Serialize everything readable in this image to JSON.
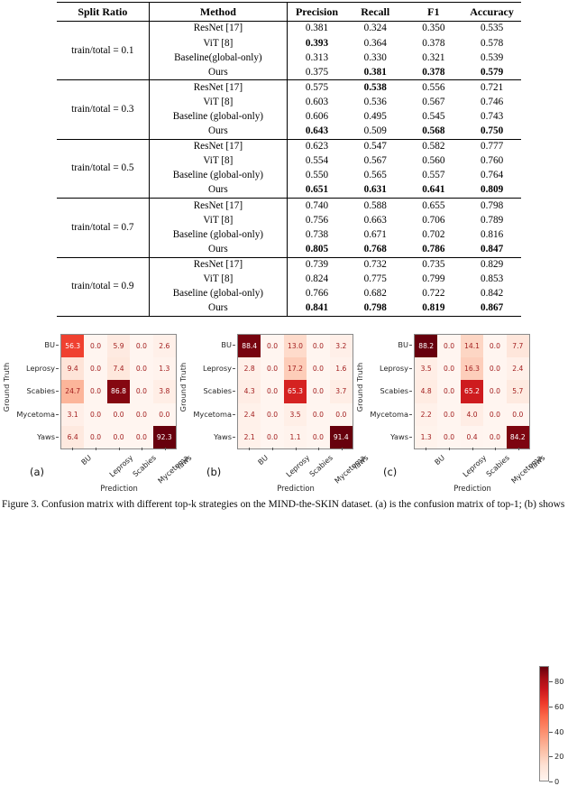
{
  "table": {
    "headers": [
      "Split Ratio",
      "Method",
      "Precision",
      "Recall",
      "F1",
      "Accuracy"
    ],
    "groups": [
      {
        "split": "train/total = 0.1",
        "rows": [
          {
            "method": "ResNet [17]",
            "precision": "0.381",
            "recall": "0.324",
            "f1": "0.350",
            "accuracy": "0.535",
            "bold": {
              "precision": false,
              "recall": false,
              "f1": false,
              "accuracy": false
            }
          },
          {
            "method": "ViT [8]",
            "precision": "0.393",
            "recall": "0.364",
            "f1": "0.378",
            "accuracy": "0.578",
            "bold": {
              "precision": true,
              "recall": false,
              "f1": false,
              "accuracy": false
            }
          },
          {
            "method": "Baseline(global-only)",
            "precision": "0.313",
            "recall": "0.330",
            "f1": "0.321",
            "accuracy": "0.539",
            "bold": {
              "precision": false,
              "recall": false,
              "f1": false,
              "accuracy": false
            }
          },
          {
            "method": "Ours",
            "precision": "0.375",
            "recall": "0.381",
            "f1": "0.378",
            "accuracy": "0.579",
            "bold": {
              "precision": false,
              "recall": true,
              "f1": true,
              "accuracy": true
            }
          }
        ]
      },
      {
        "split": "train/total = 0.3",
        "rows": [
          {
            "method": "ResNet [17]",
            "precision": "0.575",
            "recall": "0.538",
            "f1": "0.556",
            "accuracy": "0.721",
            "bold": {
              "precision": false,
              "recall": true,
              "f1": false,
              "accuracy": false
            }
          },
          {
            "method": "ViT [8]",
            "precision": "0.603",
            "recall": "0.536",
            "f1": "0.567",
            "accuracy": "0.746",
            "bold": {
              "precision": false,
              "recall": false,
              "f1": false,
              "accuracy": false
            }
          },
          {
            "method": "Baseline (global-only)",
            "precision": "0.606",
            "recall": "0.495",
            "f1": "0.545",
            "accuracy": "0.743",
            "bold": {
              "precision": false,
              "recall": false,
              "f1": false,
              "accuracy": false
            }
          },
          {
            "method": "Ours",
            "precision": "0.643",
            "recall": "0.509",
            "f1": "0.568",
            "accuracy": "0.750",
            "bold": {
              "precision": true,
              "recall": false,
              "f1": true,
              "accuracy": true
            }
          }
        ]
      },
      {
        "split": "train/total = 0.5",
        "rows": [
          {
            "method": "ResNet [17]",
            "precision": "0.623",
            "recall": "0.547",
            "f1": "0.582",
            "accuracy": "0.777",
            "bold": {
              "precision": false,
              "recall": false,
              "f1": false,
              "accuracy": false
            }
          },
          {
            "method": "ViT [8]",
            "precision": "0.554",
            "recall": "0.567",
            "f1": "0.560",
            "accuracy": "0.760",
            "bold": {
              "precision": false,
              "recall": false,
              "f1": false,
              "accuracy": false
            }
          },
          {
            "method": "Baseline (global-only)",
            "precision": "0.550",
            "recall": "0.565",
            "f1": "0.557",
            "accuracy": "0.764",
            "bold": {
              "precision": false,
              "recall": false,
              "f1": false,
              "accuracy": false
            }
          },
          {
            "method": "Ours",
            "precision": "0.651",
            "recall": "0.631",
            "f1": "0.641",
            "accuracy": "0.809",
            "bold": {
              "precision": true,
              "recall": true,
              "f1": true,
              "accuracy": true
            }
          }
        ]
      },
      {
        "split": "train/total = 0.7",
        "rows": [
          {
            "method": "ResNet [17]",
            "precision": "0.740",
            "recall": "0.588",
            "f1": "0.655",
            "accuracy": "0.798",
            "bold": {
              "precision": false,
              "recall": false,
              "f1": false,
              "accuracy": false
            }
          },
          {
            "method": "ViT [8]",
            "precision": "0.756",
            "recall": "0.663",
            "f1": "0.706",
            "accuracy": "0.789",
            "bold": {
              "precision": false,
              "recall": false,
              "f1": false,
              "accuracy": false
            }
          },
          {
            "method": "Baseline (global-only)",
            "precision": "0.738",
            "recall": "0.671",
            "f1": "0.702",
            "accuracy": "0.816",
            "bold": {
              "precision": false,
              "recall": false,
              "f1": false,
              "accuracy": false
            }
          },
          {
            "method": "Ours",
            "precision": "0.805",
            "recall": "0.768",
            "f1": "0.786",
            "accuracy": "0.847",
            "bold": {
              "precision": true,
              "recall": true,
              "f1": true,
              "accuracy": true
            }
          }
        ]
      },
      {
        "split": "train/total = 0.9",
        "rows": [
          {
            "method": "ResNet [17]",
            "precision": "0.739",
            "recall": "0.732",
            "f1": "0.735",
            "accuracy": "0.829",
            "bold": {
              "precision": false,
              "recall": false,
              "f1": false,
              "accuracy": false
            }
          },
          {
            "method": "ViT [8]",
            "precision": "0.824",
            "recall": "0.775",
            "f1": "0.799",
            "accuracy": "0.853",
            "bold": {
              "precision": false,
              "recall": false,
              "f1": false,
              "accuracy": false
            }
          },
          {
            "method": "Baseline (global-only)",
            "precision": "0.766",
            "recall": "0.682",
            "f1": "0.722",
            "accuracy": "0.842",
            "bold": {
              "precision": false,
              "recall": false,
              "f1": false,
              "accuracy": false
            }
          },
          {
            "method": "Ours",
            "precision": "0.841",
            "recall": "0.798",
            "f1": "0.819",
            "accuracy": "0.867",
            "bold": {
              "precision": true,
              "recall": true,
              "f1": true,
              "accuracy": true
            }
          }
        ]
      }
    ]
  },
  "chart_data": [
    {
      "type": "heatmap",
      "panel": "(a)",
      "title": "",
      "xlabel": "Prediction",
      "ylabel": "Ground Truth",
      "categories": [
        "BU",
        "Leprosy",
        "Scabies",
        "Mycetoma",
        "Yaws"
      ],
      "row_labels": [
        "BU",
        "Leprosy",
        "Scabies",
        "Mycetoma",
        "Yaws"
      ],
      "col_labels": [
        "BU",
        "Leprosy",
        "Scabies",
        "Mycetoma",
        "Yaws"
      ],
      "values": [
        [
          56.3,
          0.0,
          5.9,
          0.0,
          2.6
        ],
        [
          9.4,
          0.0,
          7.4,
          0.0,
          1.3
        ],
        [
          24.7,
          0.0,
          86.8,
          0.0,
          3.8
        ],
        [
          3.1,
          0.0,
          0.0,
          0.0,
          0.0
        ],
        [
          6.4,
          0.0,
          0.0,
          0.0,
          92.3
        ]
      ],
      "colormap": "Reds",
      "vmin": 0,
      "vmax": 92.3
    },
    {
      "type": "heatmap",
      "panel": "(b)",
      "title": "",
      "xlabel": "Prediction",
      "ylabel": "Ground Truth",
      "categories": [
        "BU",
        "Leprosy",
        "Scabies",
        "Mycetoma",
        "Yaws"
      ],
      "row_labels": [
        "BU",
        "Leprosy",
        "Scabies",
        "Mycetoma",
        "Yaws"
      ],
      "col_labels": [
        "BU",
        "Leprosy",
        "Scabies",
        "Mycetoma",
        "Yaws"
      ],
      "values": [
        [
          88.4,
          0.0,
          13.0,
          0.0,
          3.2
        ],
        [
          2.8,
          0.0,
          17.2,
          0.0,
          1.6
        ],
        [
          4.3,
          0.0,
          65.3,
          0.0,
          3.7
        ],
        [
          2.4,
          0.0,
          3.5,
          0.0,
          0.0
        ],
        [
          2.1,
          0.0,
          1.1,
          0.0,
          91.4
        ]
      ],
      "colormap": "Reds",
      "vmin": 0,
      "vmax": 91.4
    },
    {
      "type": "heatmap",
      "panel": "(c)",
      "title": "",
      "xlabel": "Prediction",
      "ylabel": "Ground Truth",
      "categories": [
        "BU",
        "Leprosy",
        "Scabies",
        "Mycetoma",
        "Yaws"
      ],
      "row_labels": [
        "BU",
        "Leprosy",
        "Scabies",
        "Mycetoma",
        "Yaws"
      ],
      "col_labels": [
        "BU",
        "Leprosy",
        "Scabies",
        "Mycetoma",
        "Yaws"
      ],
      "values": [
        [
          88.2,
          0.0,
          14.1,
          0.0,
          7.7
        ],
        [
          3.5,
          0.0,
          16.3,
          0.0,
          2.4
        ],
        [
          4.8,
          0.0,
          65.2,
          0.0,
          5.7
        ],
        [
          2.2,
          0.0,
          4.0,
          0.0,
          0.0
        ],
        [
          1.3,
          0.0,
          0.4,
          0.0,
          84.2
        ]
      ],
      "colormap": "Reds",
      "vmin": 0,
      "vmax": 88.2
    }
  ],
  "colorbar": {
    "ticks": [
      "0",
      "20",
      "40",
      "60",
      "80"
    ],
    "tick_values": [
      0,
      20,
      40,
      60,
      80
    ],
    "min": 0,
    "max": 92.3,
    "colormap": "Reds"
  },
  "caption": "Figure 3. Confusion matrix with different top-k strategies on the MIND-the-SKIN dataset. (a) is the confusion matrix of top-1; (b) shows"
}
